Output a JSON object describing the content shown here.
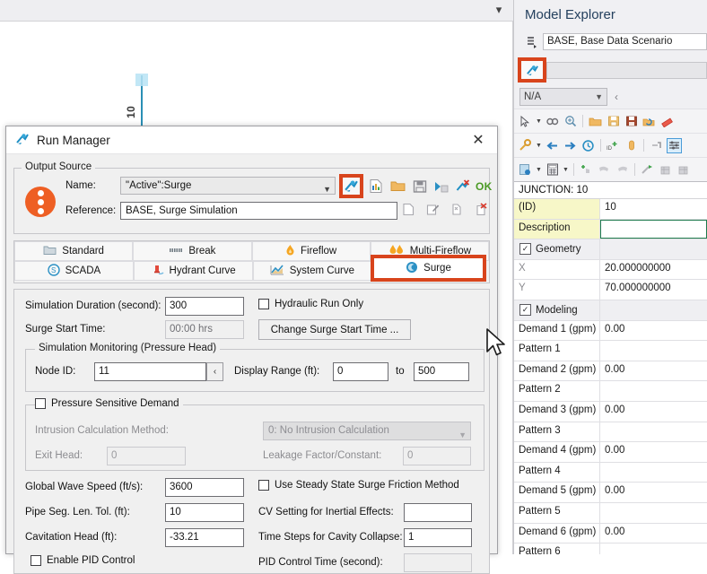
{
  "canvas": {
    "node_label": "10"
  },
  "model_explorer": {
    "title": "Model Explorer",
    "scenario_icon": "scenario-icon",
    "scenario_value": "BASE, Base Data Scenario",
    "selection_icon": "run-manager-icon",
    "selection_value": "",
    "combo_value": "N/A",
    "back_arrow": "‹",
    "toolbar_rows": [
      [
        "pointer-icon",
        "dropdown-caret",
        "link-icon",
        "zoom-in-icon",
        "sep",
        "open-folder-icon",
        "save-as-icon",
        "save-icon",
        "undo-open-icon",
        "eraser-icon"
      ],
      [
        "hammer-icon",
        "dropdown-caret",
        "arrow-left-icon",
        "arrow-right-icon",
        "history-icon",
        "sep",
        "add-id-icon",
        "pill-icon",
        "sep",
        "tap-icon",
        "sliders-icon"
      ],
      [
        "report-icon",
        "dropdown-caret",
        "calculator-icon",
        "dropdown-caret",
        "sep",
        "add-hand-icon",
        "pipe-left-icon",
        "pipe-right-icon",
        "sep",
        "elevate-icon",
        "table-left-icon",
        "table-right-icon"
      ]
    ],
    "prop_header": "JUNCTION: 10",
    "properties": [
      {
        "name": "(ID)",
        "value": "10",
        "style": "key"
      },
      {
        "name": "Description",
        "value": "",
        "style": "key focus"
      },
      {
        "name": "Geometry",
        "value": "",
        "style": "group",
        "checked": true
      },
      {
        "name": "X",
        "value": "20.000000000",
        "style": "dim"
      },
      {
        "name": "Y",
        "value": "70.000000000",
        "style": "dim"
      },
      {
        "name": "Modeling",
        "value": "",
        "style": "group",
        "checked": true
      },
      {
        "name": "Demand 1 (gpm)",
        "value": "0.00",
        "style": ""
      },
      {
        "name": "Pattern 1",
        "value": "",
        "style": ""
      },
      {
        "name": "Demand 2 (gpm)",
        "value": "0.00",
        "style": ""
      },
      {
        "name": "Pattern 2",
        "value": "",
        "style": ""
      },
      {
        "name": "Demand 3 (gpm)",
        "value": "0.00",
        "style": ""
      },
      {
        "name": "Pattern 3",
        "value": "",
        "style": ""
      },
      {
        "name": "Demand 4 (gpm)",
        "value": "0.00",
        "style": ""
      },
      {
        "name": "Pattern 4",
        "value": "",
        "style": ""
      },
      {
        "name": "Demand 5 (gpm)",
        "value": "0.00",
        "style": ""
      },
      {
        "name": "Pattern 5",
        "value": "",
        "style": ""
      },
      {
        "name": "Demand 6 (gpm)",
        "value": "0.00",
        "style": ""
      },
      {
        "name": "Pattern 6",
        "value": "",
        "style": ""
      }
    ]
  },
  "run_manager": {
    "title": "Run Manager",
    "title_icon": "run-manager-icon",
    "close_label": "✕",
    "output_source": {
      "legend": "Output Source",
      "name_label": "Name:",
      "name_value": "\"Active\":Surge",
      "reference_label": "Reference:",
      "reference_value": "BASE, Surge Simulation",
      "ok_label": "OK",
      "top_icons": [
        "run-icon",
        "report-icon",
        "open-folder-icon",
        "save-icon",
        "rerun-icon",
        "delete-run-icon"
      ],
      "bottom_icons": [
        "new-icon",
        "edit-icon",
        "duplicate-icon",
        "delete-icon"
      ]
    },
    "tabs": [
      {
        "label": "Standard",
        "icon": "folder-icon",
        "active": false
      },
      {
        "label": "Break",
        "icon": "break-icon",
        "active": false
      },
      {
        "label": "Fireflow",
        "icon": "flame-icon",
        "active": false
      },
      {
        "label": "Multi-Fireflow",
        "icon": "double-flame-icon",
        "active": false
      },
      {
        "label": "SCADA",
        "icon": "scada-icon",
        "active": false
      },
      {
        "label": "Hydrant Curve",
        "icon": "hydrant-icon",
        "active": false
      },
      {
        "label": "System Curve",
        "icon": "chart-icon",
        "active": false
      },
      {
        "label": "Surge",
        "icon": "surge-icon",
        "active": true
      }
    ],
    "settings": {
      "simulation_duration_label": "Simulation Duration (second):",
      "simulation_duration_value": "300",
      "hydraulic_run_only_label": "Hydraulic Run Only",
      "hydraulic_run_only_checked": false,
      "surge_start_time_label": "Surge Start Time:",
      "surge_start_time_value": "00:00 hrs",
      "change_surge_start_time_label": "Change Surge Start Time ...",
      "monitoring_legend": "Simulation Monitoring (Pressure Head)",
      "node_id_label": "Node ID:",
      "node_id_value": "11",
      "node_pick_label": "‹",
      "display_range_label": "Display Range (ft):",
      "display_range_from": "0",
      "display_range_to_label": "to",
      "display_range_to": "500",
      "psd_legend": "Pressure Sensitive Demand",
      "psd_checked": false,
      "intrusion_label": "Intrusion Calculation Method:",
      "intrusion_value": "0: No Intrusion Calculation",
      "exit_head_label": "Exit Head:",
      "exit_head_value": "0",
      "leakage_label": "Leakage Factor/Constant:",
      "leakage_value": "0",
      "global_wave_speed_label": "Global Wave Speed (ft/s):",
      "global_wave_speed_value": "3600",
      "steady_state_label": "Use Steady State Surge Friction Method",
      "steady_state_checked": false,
      "pipe_seg_label": "Pipe Seg. Len. Tol. (ft):",
      "pipe_seg_value": "10",
      "cv_setting_label": "CV Setting for Inertial Effects:",
      "cv_setting_value": "",
      "cavitation_label": "Cavitation Head (ft):",
      "cavitation_value": "-33.21",
      "time_steps_label": "Time Steps for Cavity Collapse:",
      "time_steps_value": "1",
      "pid_enable_label": "Enable PID Control",
      "pid_enable_checked": false,
      "pid_time_label": "PID Control Time (second):",
      "pid_time_value": ""
    }
  },
  "colors": {
    "highlight": "#d8441c",
    "accent_orange": "#ee5f24",
    "ok_green": "#4a9a24",
    "pipe_blue": "#2a8fb5"
  }
}
